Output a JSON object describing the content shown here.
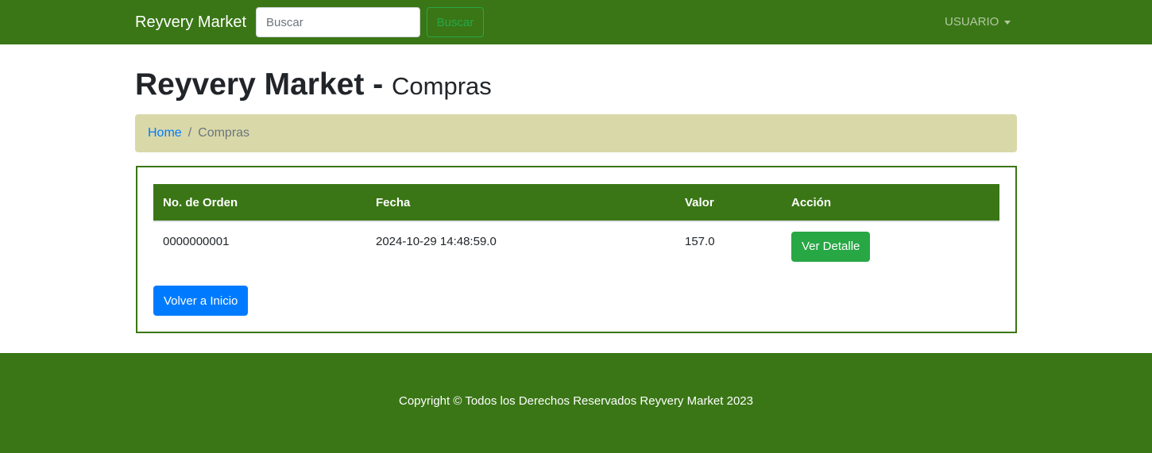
{
  "navbar": {
    "brand": "Reyvery Market",
    "search_placeholder": "Buscar",
    "search_button": "Buscar",
    "user_menu": "USUARIO"
  },
  "header": {
    "title": "Reyvery Market",
    "separator": "-",
    "subtitle": "Compras"
  },
  "breadcrumb": {
    "home": "Home",
    "separator": "/",
    "current": "Compras"
  },
  "table": {
    "columns": [
      "No. de Orden",
      "Fecha",
      "Valor",
      "Acción"
    ],
    "rows": [
      {
        "order": "0000000001",
        "date": "2024-10-29 14:48:59.0",
        "value": "157.0",
        "action": "Ver Detalle"
      }
    ]
  },
  "actions": {
    "back_home": "Volver a Inicio"
  },
  "footer": {
    "copyright": "Copyright © Todos los Derechos Reservados Reyvery Market 2023"
  },
  "colors": {
    "primary_green": "#3a7616",
    "breadcrumb_bg": "#d9d8a9",
    "success": "#28a745",
    "link_blue": "#007bff"
  }
}
